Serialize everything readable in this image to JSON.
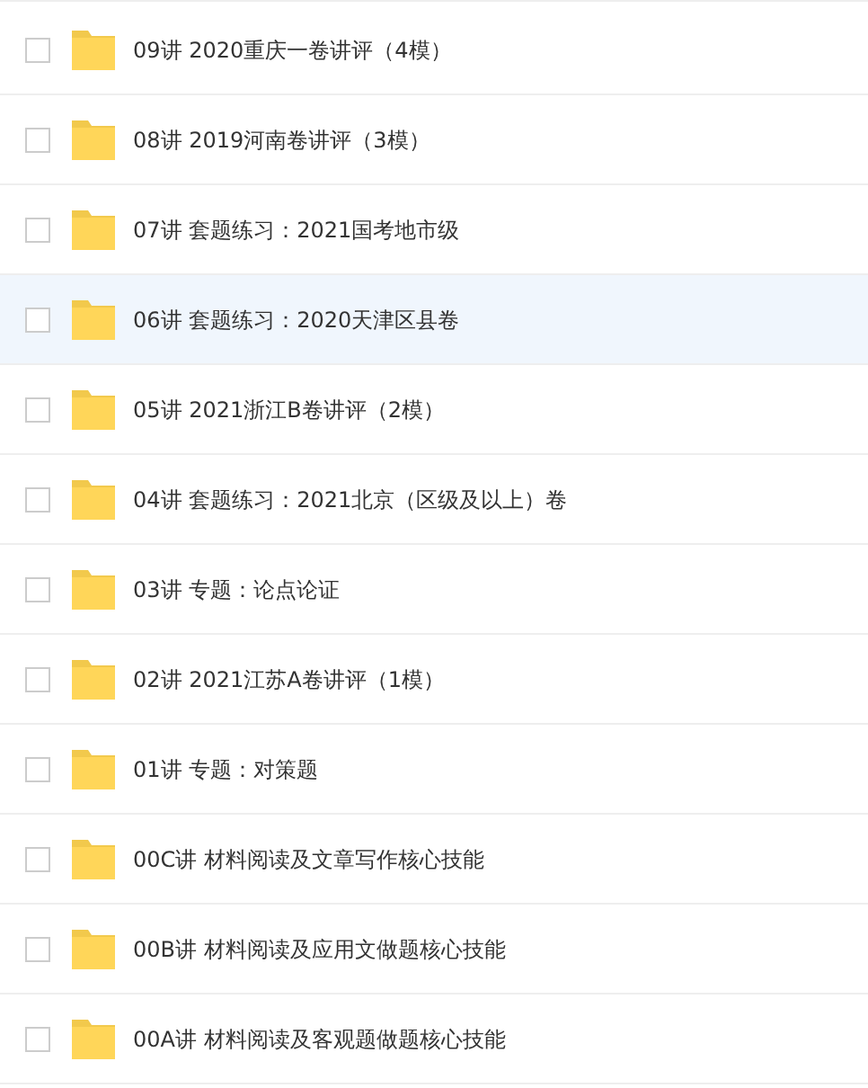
{
  "folders": [
    {
      "name": "09讲 2020重庆一卷讲评（4模）",
      "checked": false,
      "highlighted": false
    },
    {
      "name": "08讲 2019河南卷讲评（3模）",
      "checked": false,
      "highlighted": false
    },
    {
      "name": "07讲 套题练习：2021国考地市级",
      "checked": false,
      "highlighted": false
    },
    {
      "name": "06讲 套题练习：2020天津区县卷",
      "checked": false,
      "highlighted": true
    },
    {
      "name": "05讲 2021浙江B卷讲评（2模）",
      "checked": false,
      "highlighted": false
    },
    {
      "name": "04讲 套题练习：2021北京（区级及以上）卷",
      "checked": false,
      "highlighted": false
    },
    {
      "name": "03讲 专题：论点论证",
      "checked": false,
      "highlighted": false
    },
    {
      "name": "02讲 2021江苏A卷讲评（1模）",
      "checked": false,
      "highlighted": false
    },
    {
      "name": "01讲 专题：对策题",
      "checked": false,
      "highlighted": false
    },
    {
      "name": "00C讲 材料阅读及文章写作核心技能",
      "checked": false,
      "highlighted": false
    },
    {
      "name": "00B讲 材料阅读及应用文做题核心技能",
      "checked": false,
      "highlighted": false
    },
    {
      "name": "00A讲 材料阅读及客观题做题核心技能",
      "checked": false,
      "highlighted": false
    }
  ]
}
